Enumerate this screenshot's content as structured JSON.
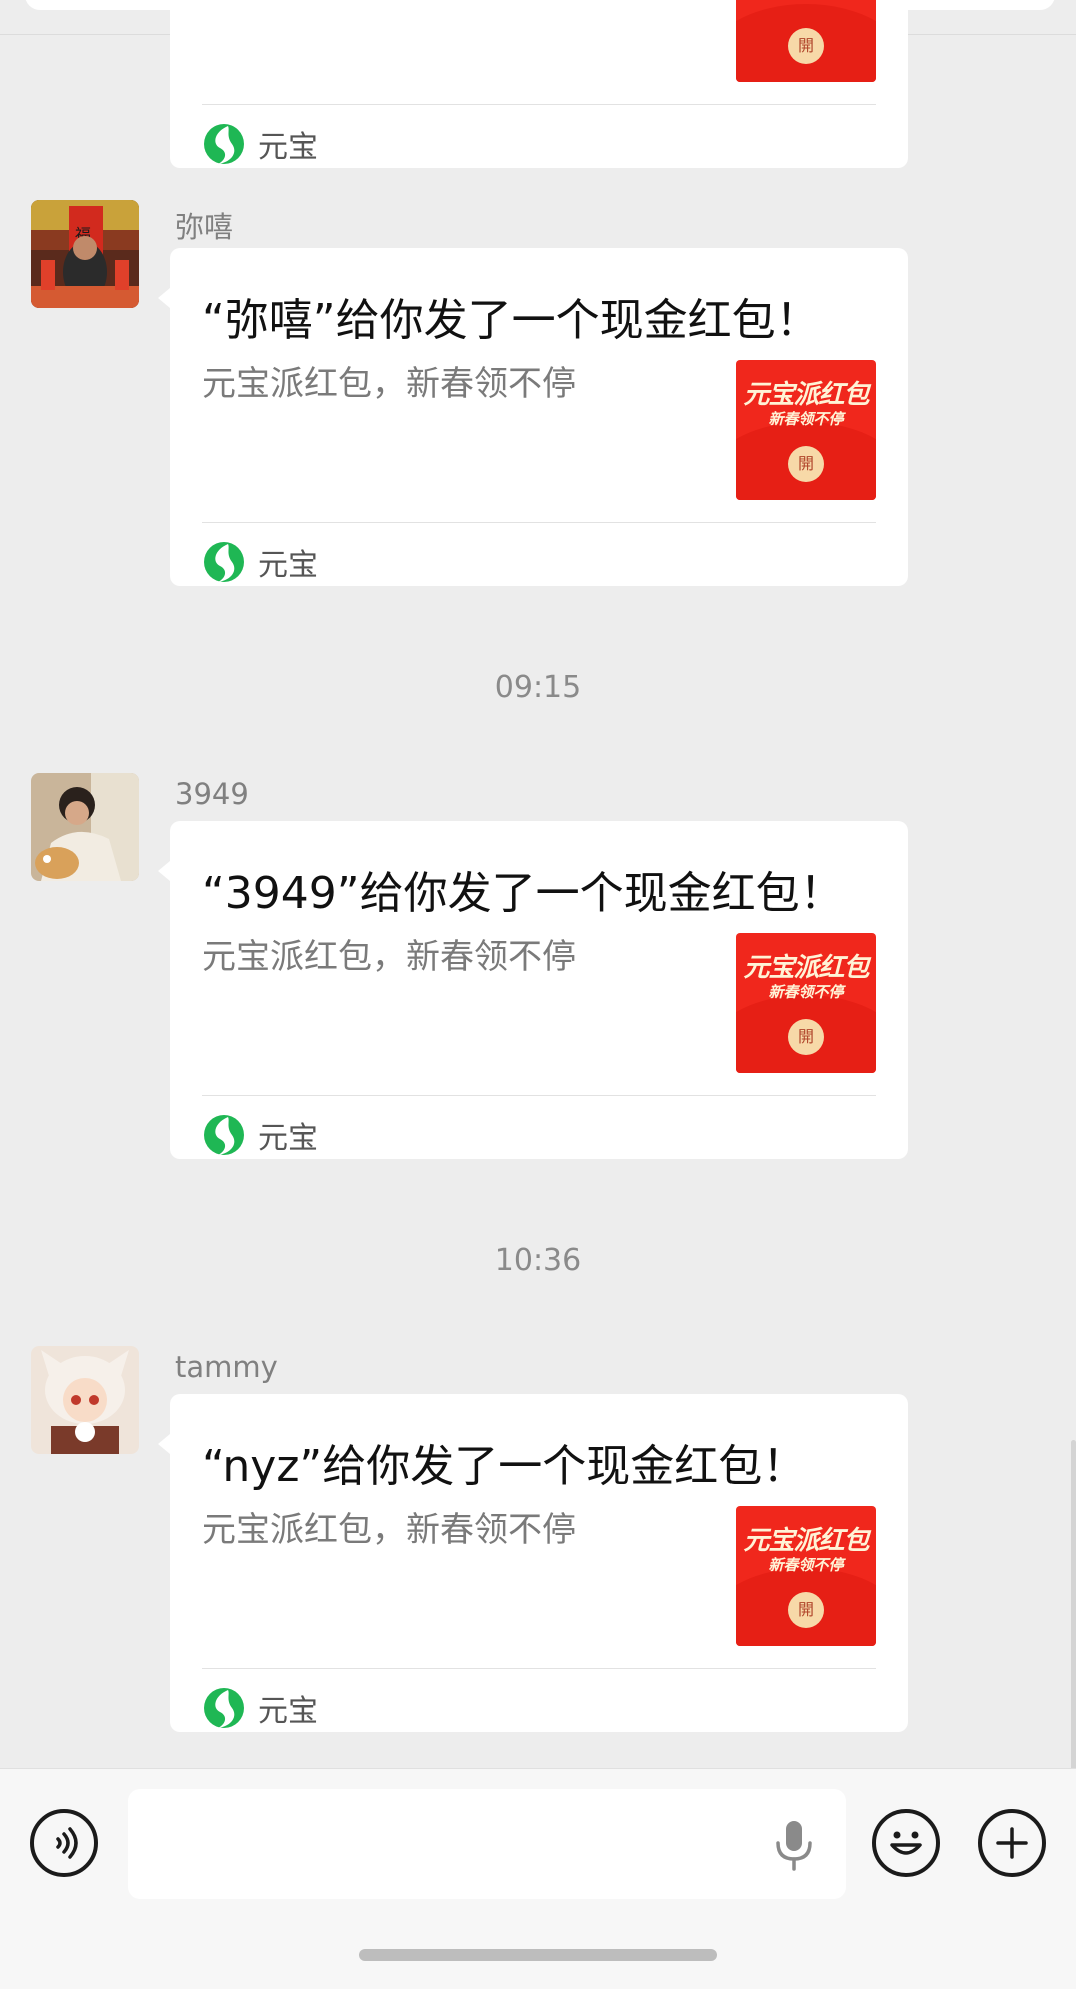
{
  "top_card": {
    "footer_label": "元宝"
  },
  "messages": [
    {
      "sender": "弥嘻",
      "title": "“弥嘻”给你发了一个现金红包！",
      "subtitle": "元宝派红包，新春领不停",
      "packet_title": "元宝派红包",
      "packet_sub": "新春领不停",
      "packet_button": "開",
      "footer_label": "元宝"
    },
    {
      "time": "09:15",
      "sender": "3949",
      "title": "“3949”给你发了一个现金红包！",
      "subtitle": "元宝派红包，新春领不停",
      "packet_title": "元宝派红包",
      "packet_sub": "新春领不停",
      "packet_button": "開",
      "footer_label": "元宝"
    },
    {
      "time": "10:36",
      "sender": "tammy",
      "title": "“nyz”给你发了一个现金红包！",
      "subtitle": "元宝派红包，新春领不停",
      "packet_title": "元宝派红包",
      "packet_sub": "新春领不停",
      "packet_button": "開",
      "footer_label": "元宝"
    }
  ],
  "input_bar": {
    "text_value": "",
    "icons": [
      "voice-icon",
      "microphone-icon",
      "emoji-icon",
      "plus-icon"
    ]
  },
  "colors": {
    "background": "#ededed",
    "red_packet": "#f0271c",
    "yuanbao_logo": "#1fb754"
  }
}
